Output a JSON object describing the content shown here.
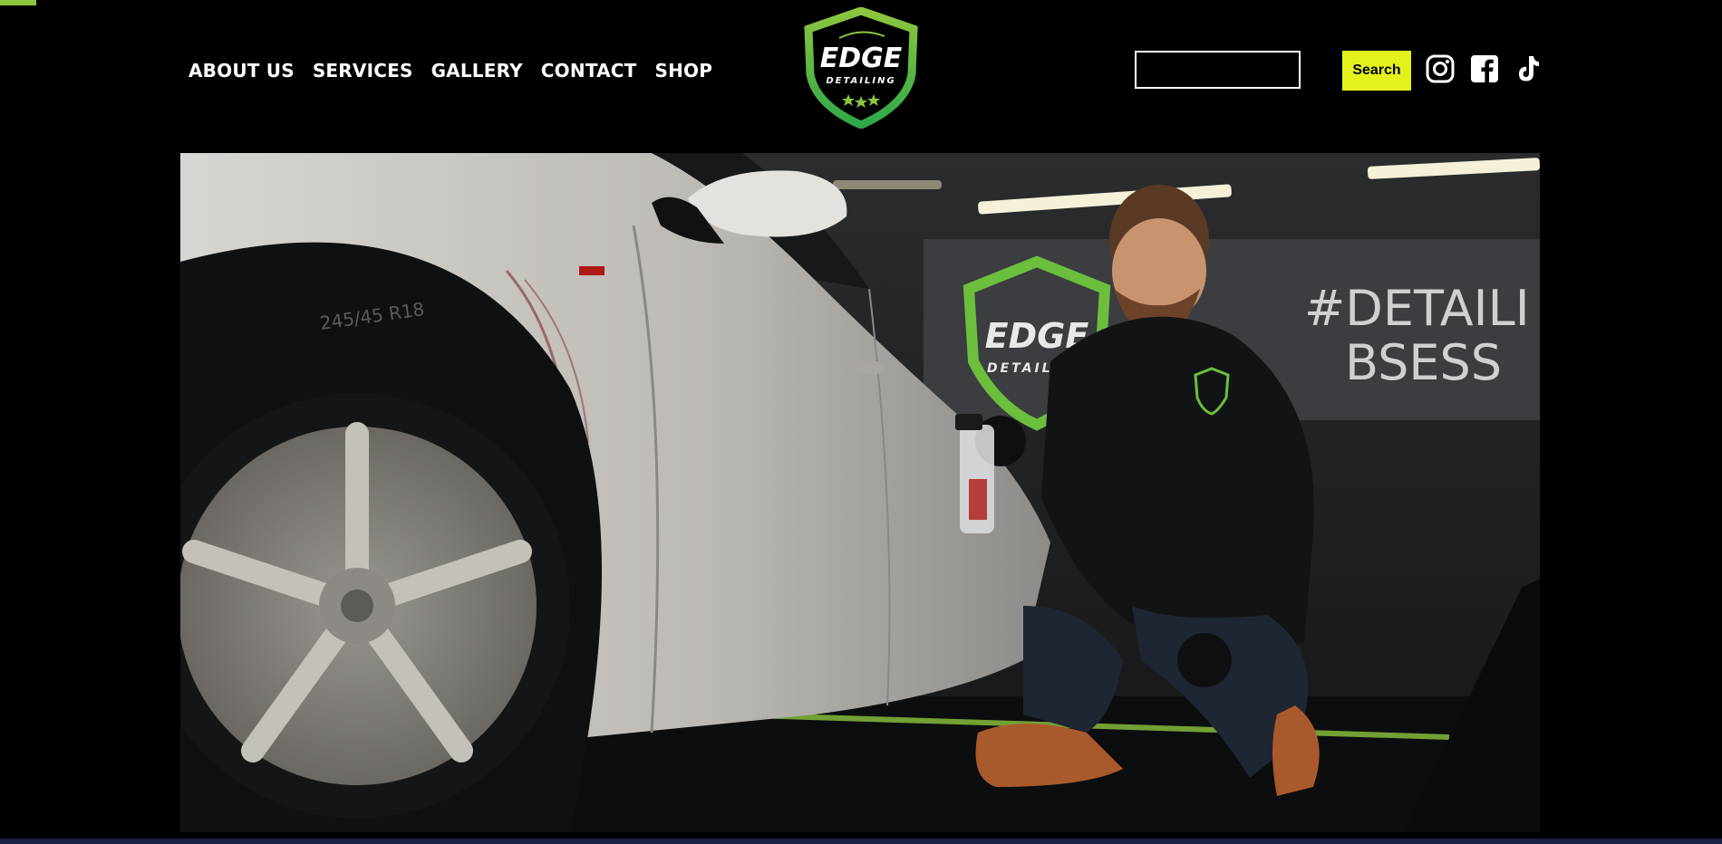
{
  "brand": {
    "logo_text": "EDGE",
    "logo_subtext": "DETAILING",
    "accent_color": "#8dc63f",
    "search_button_color": "#e4f21c"
  },
  "nav": {
    "items": [
      {
        "label": "ABOUT US"
      },
      {
        "label": "SERVICES"
      },
      {
        "label": "GALLERY"
      },
      {
        "label": "CONTACT"
      },
      {
        "label": "SHOP"
      }
    ]
  },
  "search": {
    "value": "",
    "placeholder": "",
    "button_label": "Search"
  },
  "social": {
    "icons": [
      "instagram-icon",
      "facebook-icon",
      "tiktok-icon"
    ]
  },
  "hero": {
    "wall_sign_text_line1": "#DETAILI",
    "wall_sign_text_line2": "BSESS",
    "wall_logo_text": "EDGE",
    "wall_logo_subtext": "DETAILING",
    "tyre_text": "245/45 R18"
  }
}
